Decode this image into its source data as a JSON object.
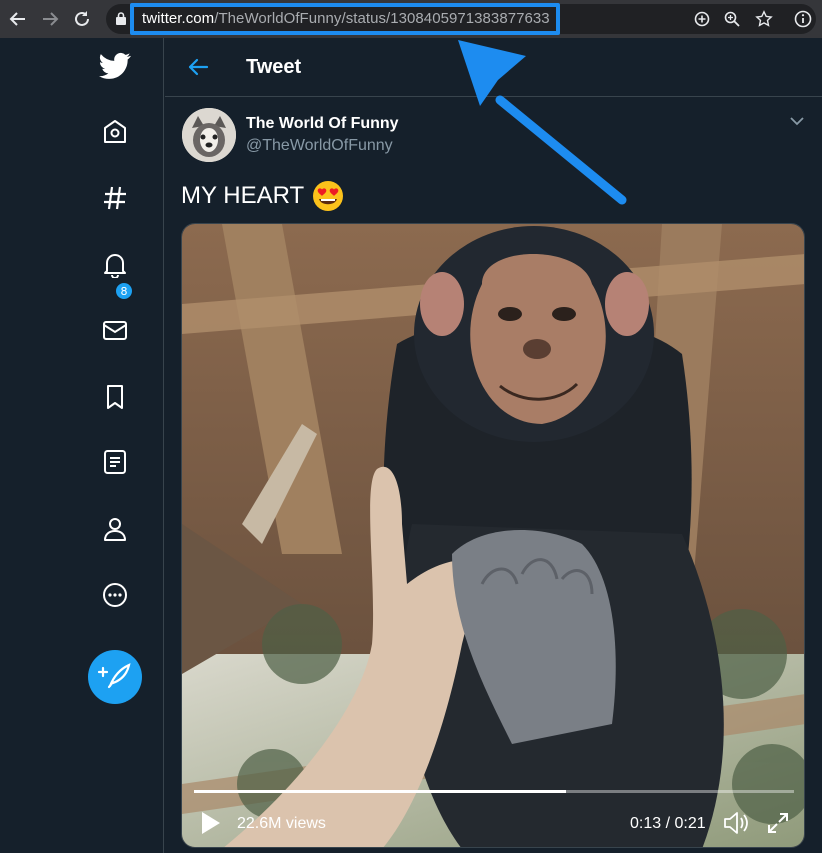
{
  "browser": {
    "url_host": "twitter.com",
    "url_path": "/TheWorldOfFunny/status/1308405971383877633"
  },
  "sidebar": {
    "items": [
      {
        "name": "twitter-logo-icon"
      },
      {
        "name": "home-icon"
      },
      {
        "name": "explore-hashtag-icon"
      },
      {
        "name": "notifications-bell-icon"
      },
      {
        "name": "messages-envelope-icon"
      },
      {
        "name": "bookmarks-icon"
      },
      {
        "name": "lists-icon"
      },
      {
        "name": "profile-icon"
      },
      {
        "name": "more-icon"
      }
    ],
    "notifications_count": "8",
    "compose_icon": "feather-plus-icon"
  },
  "header": {
    "title": "Tweet"
  },
  "tweet": {
    "author_name": "The World Of Funny",
    "author_handle": "@TheWorldOfFunny",
    "text": "MY HEART",
    "text_emoji": "heart-eyes-emoji"
  },
  "video": {
    "views": "22.6M views",
    "time": "0:13 / 0:21",
    "progress": 0.62
  },
  "colors": {
    "background": "#15202b",
    "accent": "#1da1f2",
    "annotation": "#1d8cf0"
  }
}
